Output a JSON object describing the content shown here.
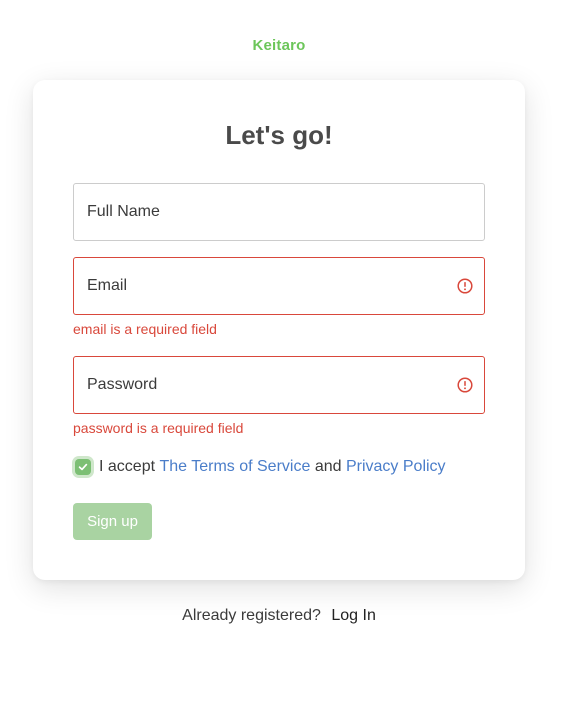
{
  "brand": {
    "logo_text": "Keitaro",
    "color": "#6cc65a"
  },
  "form": {
    "title": "Let's go!",
    "full_name": {
      "placeholder": "Full Name",
      "value": ""
    },
    "email": {
      "placeholder": "Email",
      "value": "",
      "error": "email is a required field"
    },
    "password": {
      "placeholder": "Password",
      "value": "",
      "error": "password is a required field"
    },
    "terms": {
      "checked": true,
      "prefix": "I accept",
      "terms_link": "The Terms of Service",
      "conjunction": "and",
      "privacy_link": "Privacy Policy"
    },
    "submit_label": "Sign up",
    "submit_disabled": true
  },
  "footer": {
    "prompt": "Already registered?",
    "login_link": "Log In"
  },
  "colors": {
    "error": "#d9483b",
    "link": "#4a7dc9",
    "button_disabled": "#a9d3a2",
    "checkbox": "#7cbf74"
  },
  "icons": {
    "error": "alert-circle-icon",
    "checkbox": "check-icon"
  }
}
